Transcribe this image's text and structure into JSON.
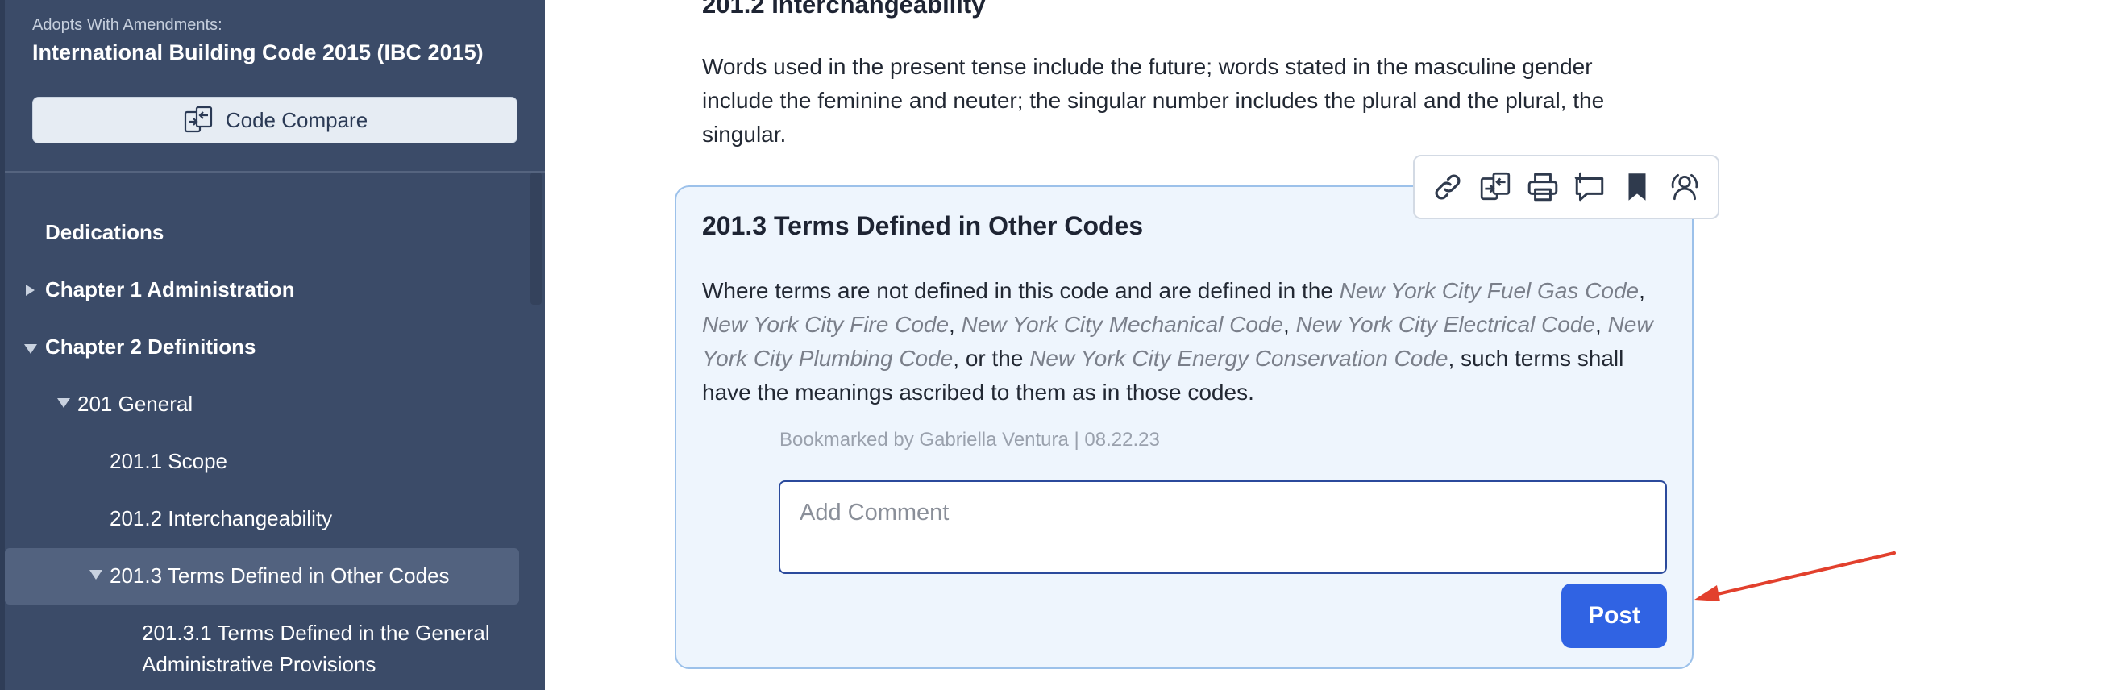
{
  "sidebar": {
    "adopts_label": "Adopts With Amendments:",
    "code_title": "International Building Code 2015 (IBC 2015)",
    "compare_label": "Code Compare",
    "items": [
      {
        "label": "Dedications"
      },
      {
        "label": "Chapter 1 Administration"
      },
      {
        "label": "Chapter 2 Definitions"
      },
      {
        "label": "201 General"
      },
      {
        "label": "201.1 Scope"
      },
      {
        "label": "201.2 Interchangeability"
      },
      {
        "label": "201.3 Terms Defined in Other Codes"
      },
      {
        "label": "201.3.1 Terms Defined in the General"
      },
      {
        "label": "Administrative Provisions"
      }
    ]
  },
  "main": {
    "prev_heading": "201.2 Interchangeability",
    "prev_text": "Words used in the present tense include the future; words stated in the masculine gender include the feminine and neuter; the singular number includes the plural and the plural, the singular.",
    "card": {
      "heading": "201.3 Terms Defined in Other Codes",
      "text_1": "Where terms are not defined in this code and are defined in the ",
      "ref_fuel_gas": "New York City Fuel Gas Code",
      "sep_1": ", ",
      "ref_fire": "New York City Fire Code",
      "sep_2": ", ",
      "ref_mechanical": "New York City Mechanical Code",
      "sep_3": ", ",
      "ref_electrical": "New York City Electrical Code",
      "sep_4": ", ",
      "ref_plumbing": "New York City Plumbing Code",
      "text_2": ", or the ",
      "ref_energy": "New York City Energy Conservation Code",
      "text_3": ", such terms shall have the meanings ascribed to them as in those codes.",
      "bookmark_meta": "Bookmarked by Gabriella Ventura | 08.22.23",
      "comment_placeholder": "Add Comment",
      "post_label": "Post"
    },
    "toolbar": [
      "link-icon",
      "compare-icon",
      "print-icon",
      "comment-icon",
      "bookmark-icon",
      "share-icon"
    ]
  },
  "colors": {
    "sidebar_bg": "#3b4b68",
    "accent": "#3063e3",
    "card_bg": "#eef5fd",
    "annotation": "#e2402d"
  }
}
